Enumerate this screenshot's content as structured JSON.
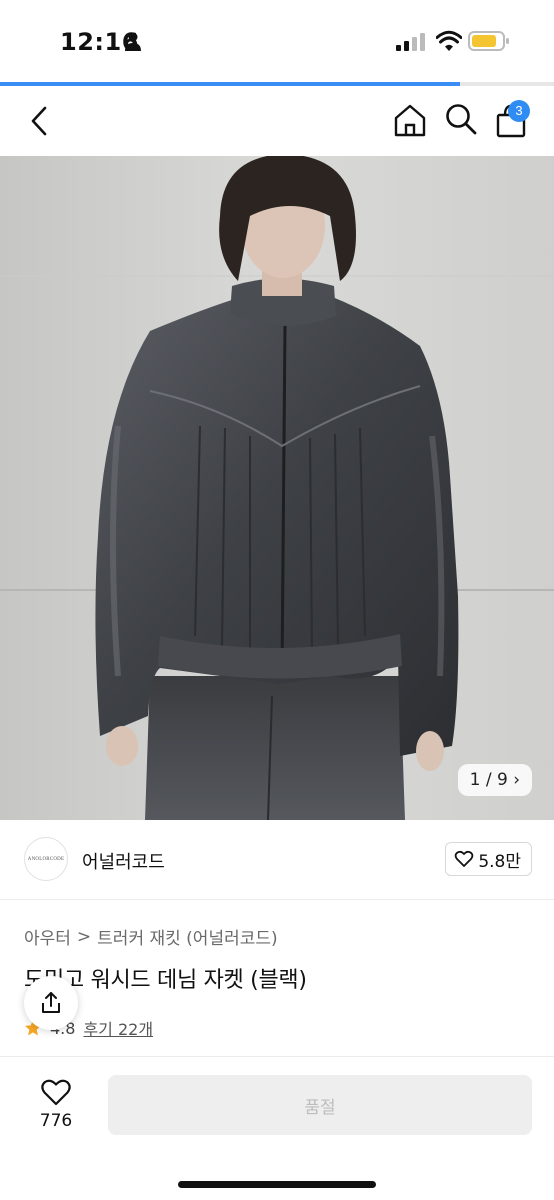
{
  "status_bar": {
    "time": "12:16",
    "icons": [
      "person-icon",
      "signal-icon",
      "wifi-icon",
      "battery-icon"
    ],
    "battery_color": "#f4c531"
  },
  "page_load": {
    "progress_percent": 83,
    "color": "#3a8df5"
  },
  "nav": {
    "icons": [
      "back-icon",
      "home-icon",
      "search-icon",
      "cart-icon"
    ],
    "cart_count": "3",
    "badge_color": "#2f8cf3"
  },
  "hero": {
    "page_indicator": "1 / 9",
    "indicator_arrow": "›"
  },
  "brand": {
    "logo_text": "ANOLORCODE",
    "name": "어널러코드",
    "likes": "5.8만"
  },
  "product": {
    "breadcrumb": [
      "아우터",
      "트러커 재킷 (어널러코드)"
    ],
    "breadcrumb_separator": ">",
    "title": "도밍고 워시드 데님 자켓 (블랙)",
    "rating": "4.8",
    "review_link": "후기 22개"
  },
  "bottom": {
    "wish_count": "776",
    "soldout_label": "품절"
  },
  "colors": {
    "accent": "#2f8cf3",
    "soldout_bg": "#eeeeee",
    "soldout_text": "#bdbdbd",
    "star": "#f5a623"
  }
}
